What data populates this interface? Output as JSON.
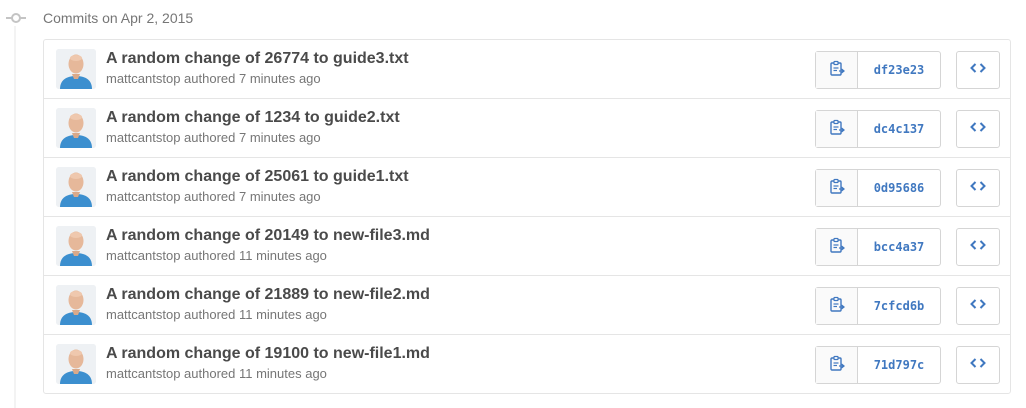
{
  "group": {
    "title": "Commits on Apr 2, 2015"
  },
  "icons": {
    "commit_node": "git-commit-icon",
    "copy": "clippy-icon",
    "browse": "code-icon"
  },
  "colors": {
    "sha": "#4078c0",
    "title": "#4a4a4a",
    "muted": "#767676",
    "border": "#e5e5e5"
  },
  "commits": [
    {
      "title": "A random change of 26774 to guide3.txt",
      "author": "mattcantstop",
      "meta_rest": " authored 7 minutes ago",
      "sha": "df23e23"
    },
    {
      "title": "A random change of 1234 to guide2.txt",
      "author": "mattcantstop",
      "meta_rest": " authored 7 minutes ago",
      "sha": "dc4c137"
    },
    {
      "title": "A random change of 25061 to guide1.txt",
      "author": "mattcantstop",
      "meta_rest": " authored 7 minutes ago",
      "sha": "0d95686"
    },
    {
      "title": "A random change of 20149 to new-file3.md",
      "author": "mattcantstop",
      "meta_rest": " authored 11 minutes ago",
      "sha": "bcc4a37"
    },
    {
      "title": "A random change of 21889 to new-file2.md",
      "author": "mattcantstop",
      "meta_rest": " authored 11 minutes ago",
      "sha": "7cfcd6b"
    },
    {
      "title": "A random change of 19100 to new-file1.md",
      "author": "mattcantstop",
      "meta_rest": " authored 11 minutes ago",
      "sha": "71d797c"
    }
  ]
}
